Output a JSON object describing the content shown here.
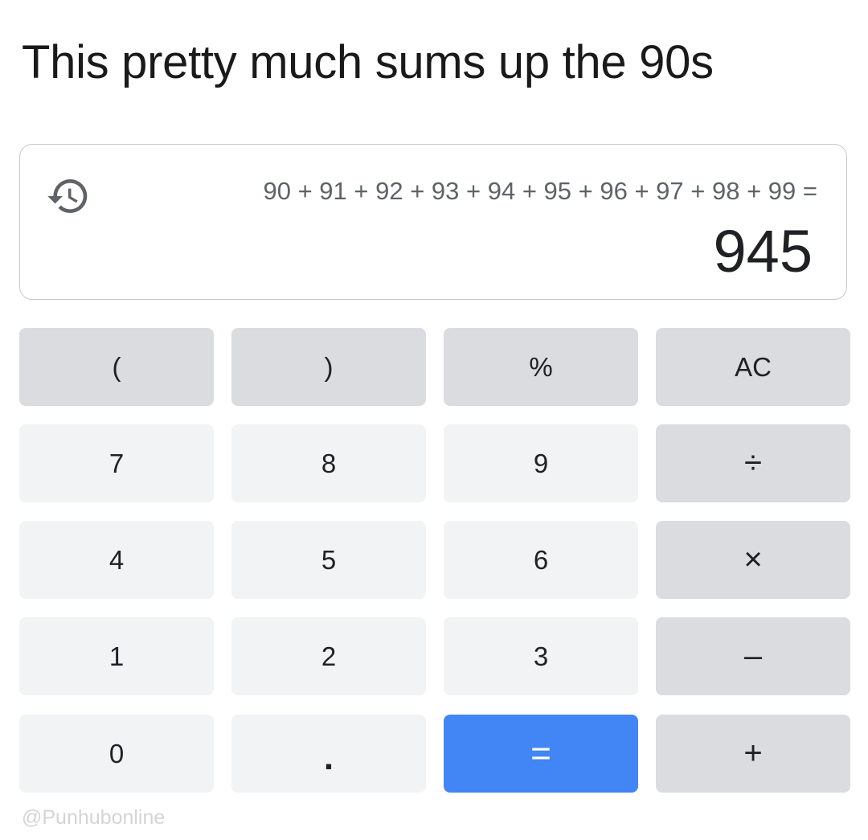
{
  "caption": "This pretty much sums up the 90s",
  "display": {
    "history_icon": "history-icon",
    "expression": "90 + 91 + 92 + 93 + 94 + 95 + 96 + 97 + 98 + 99 =",
    "result": "945"
  },
  "keys": {
    "open_paren": "(",
    "close_paren": ")",
    "percent": "%",
    "clear": "AC",
    "seven": "7",
    "eight": "8",
    "nine": "9",
    "divide": "÷",
    "four": "4",
    "five": "5",
    "six": "6",
    "multiply": "×",
    "one": "1",
    "two": "2",
    "three": "3",
    "minus": "–",
    "zero": "0",
    "decimal": ".",
    "equals": "=",
    "plus": "+"
  },
  "colors": {
    "equals_button": "#4285f4",
    "function_key": "#dadce0",
    "digit_key": "#f1f3f4",
    "display_border": "#c8c8c8"
  },
  "watermark": "@Punhubonline"
}
